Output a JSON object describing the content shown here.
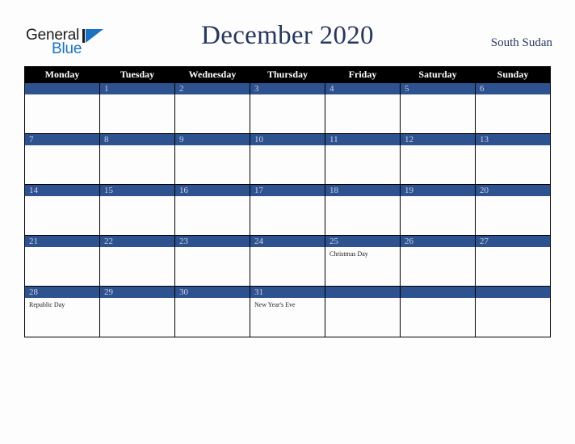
{
  "logo": {
    "word_one": "General",
    "word_two": "Blue",
    "triangle_icon": "triangle-icon",
    "primary_color": "#1b72c0",
    "text_color": "#1a1a1a"
  },
  "header": {
    "title": "December 2020",
    "country": "South Sudan",
    "title_color": "#27375e"
  },
  "calendar": {
    "month": "December",
    "year": "2020",
    "accent_color": "#2e5190",
    "header_bg": "#000000",
    "weekdays": [
      "Monday",
      "Tuesday",
      "Wednesday",
      "Thursday",
      "Friday",
      "Saturday",
      "Sunday"
    ],
    "weeks": [
      [
        {
          "day": "",
          "holiday": ""
        },
        {
          "day": "1",
          "holiday": ""
        },
        {
          "day": "2",
          "holiday": ""
        },
        {
          "day": "3",
          "holiday": ""
        },
        {
          "day": "4",
          "holiday": ""
        },
        {
          "day": "5",
          "holiday": ""
        },
        {
          "day": "6",
          "holiday": ""
        }
      ],
      [
        {
          "day": "7",
          "holiday": ""
        },
        {
          "day": "8",
          "holiday": ""
        },
        {
          "day": "9",
          "holiday": ""
        },
        {
          "day": "10",
          "holiday": ""
        },
        {
          "day": "11",
          "holiday": ""
        },
        {
          "day": "12",
          "holiday": ""
        },
        {
          "day": "13",
          "holiday": ""
        }
      ],
      [
        {
          "day": "14",
          "holiday": ""
        },
        {
          "day": "15",
          "holiday": ""
        },
        {
          "day": "16",
          "holiday": ""
        },
        {
          "day": "17",
          "holiday": ""
        },
        {
          "day": "18",
          "holiday": ""
        },
        {
          "day": "19",
          "holiday": ""
        },
        {
          "day": "20",
          "holiday": ""
        }
      ],
      [
        {
          "day": "21",
          "holiday": ""
        },
        {
          "day": "22",
          "holiday": ""
        },
        {
          "day": "23",
          "holiday": ""
        },
        {
          "day": "24",
          "holiday": ""
        },
        {
          "day": "25",
          "holiday": "Christmas Day"
        },
        {
          "day": "26",
          "holiday": ""
        },
        {
          "day": "27",
          "holiday": ""
        }
      ],
      [
        {
          "day": "28",
          "holiday": "Republic Day"
        },
        {
          "day": "29",
          "holiday": ""
        },
        {
          "day": "30",
          "holiday": ""
        },
        {
          "day": "31",
          "holiday": "New Year's Eve"
        },
        {
          "day": "",
          "holiday": ""
        },
        {
          "day": "",
          "holiday": ""
        },
        {
          "day": "",
          "holiday": ""
        }
      ]
    ]
  }
}
